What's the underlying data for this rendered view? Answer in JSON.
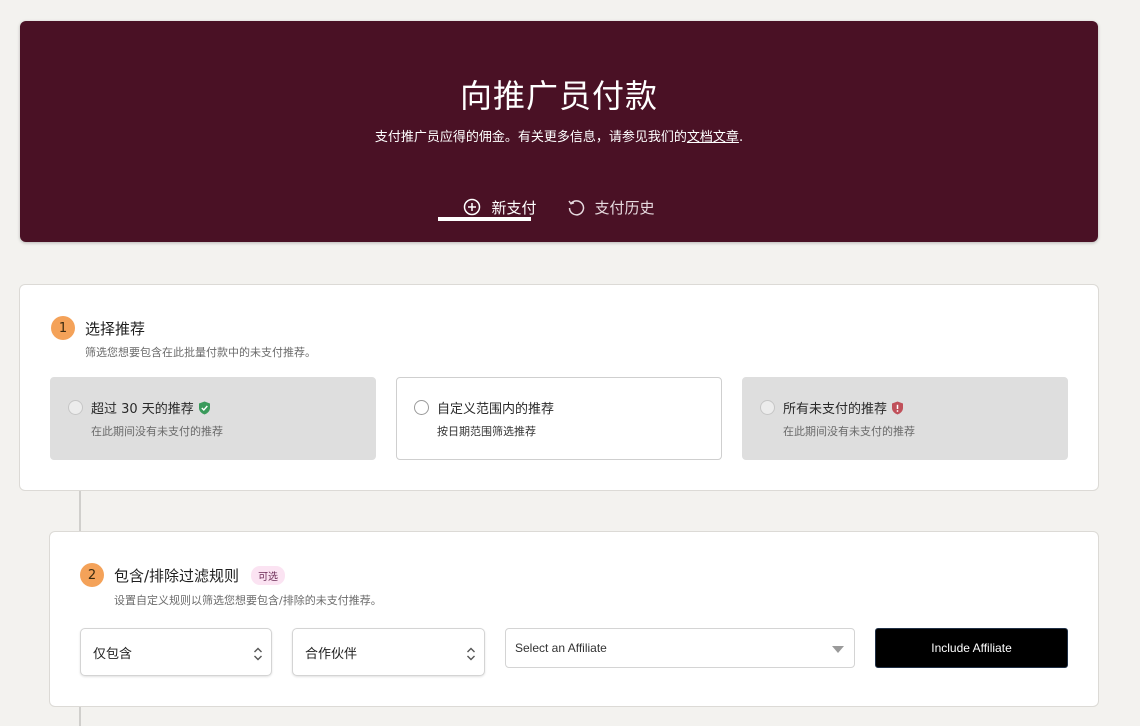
{
  "hero": {
    "title": "向推广员付款",
    "description": "支付推广员应得的佣金。有关更多信息，请参见我们的",
    "doc_link": "文档文章",
    "description_end": ".",
    "tabs": [
      {
        "label": "新支付",
        "icon": "plus-circle-icon",
        "active": true
      },
      {
        "label": "支付历史",
        "icon": "history-icon",
        "active": false
      }
    ]
  },
  "step1": {
    "number": "1",
    "title": "选择推荐",
    "subtitle": "筛选您想要包含在此批量付款中的未支付推荐。",
    "options": [
      {
        "title": "超过 30 天的推荐",
        "description": "在此期间没有未支付的推荐",
        "icon": "shield-check-icon",
        "disabled": true
      },
      {
        "title": "自定义范围内的推荐",
        "description": "按日期范围筛选推荐",
        "disabled": false
      },
      {
        "title": "所有未支付的推荐",
        "description": "在此期间没有未支付的推荐",
        "icon": "shield-alert-icon",
        "disabled": true
      }
    ]
  },
  "step2": {
    "number": "2",
    "title": "包含/排除过滤规则",
    "badge": "可选",
    "subtitle": "设置自定义规则以筛选您想要包含/排除的未支付推荐。",
    "mode_select": "仅包含",
    "type_select": "合作伙伴",
    "affiliate_placeholder": "Select an Affiliate",
    "include_button": "Include Affiliate"
  },
  "colors": {
    "hero_bg": "#4a1125",
    "step_badge": "#f4a259",
    "page_bg": "#f3f2ef",
    "shield_ok": "#3a9a5b",
    "shield_warn": "#c0505a"
  }
}
